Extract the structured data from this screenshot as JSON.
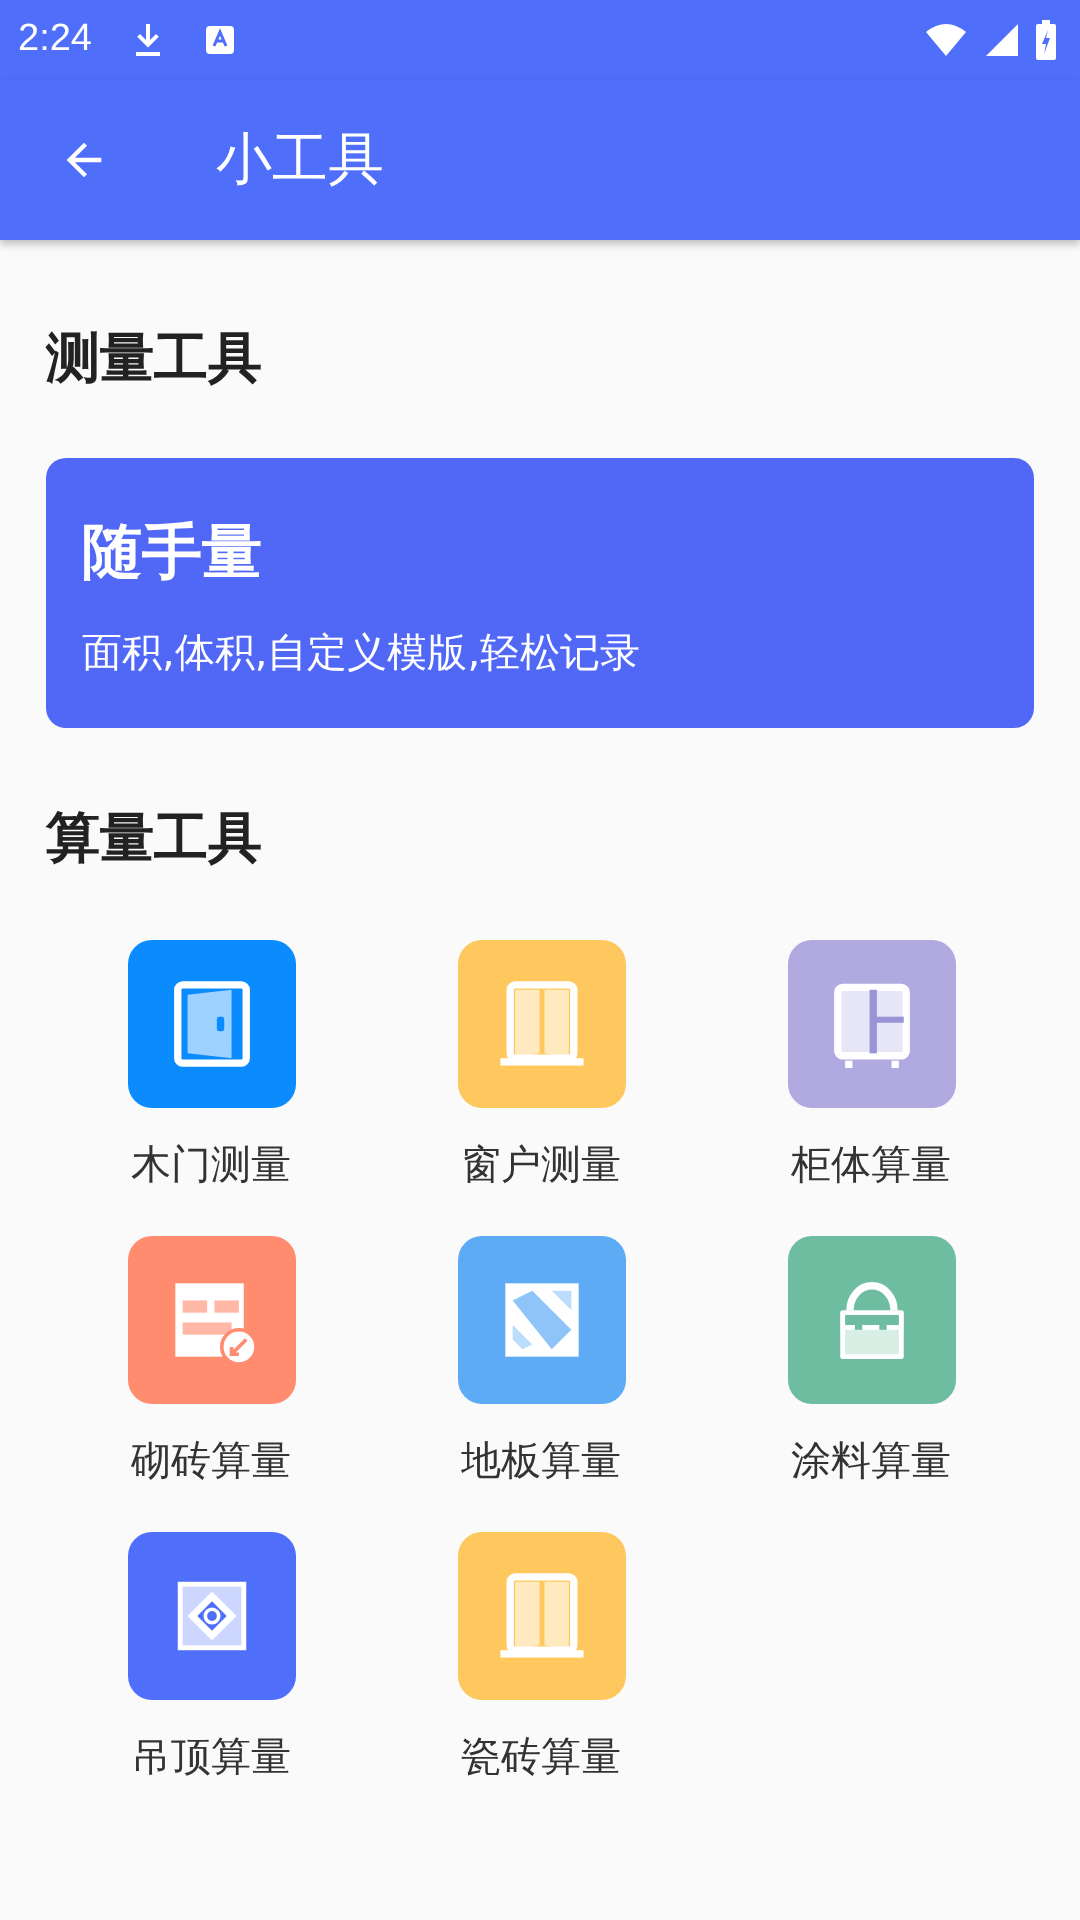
{
  "status_bar": {
    "time": "2:24"
  },
  "app_bar": {
    "title": "小工具"
  },
  "sections": [
    {
      "title": "测量工具",
      "card": {
        "title": "随手量",
        "subtitle": "面积,体积,自定义模版,轻松记录"
      }
    },
    {
      "title": "算量工具",
      "tools": [
        {
          "label": "木门测量",
          "kind": "door",
          "color": "#0a8cff"
        },
        {
          "label": "窗户测量",
          "kind": "wardrobe",
          "color": "#ffc85f"
        },
        {
          "label": "柜体算量",
          "kind": "cabinet",
          "color": "#b0aae0"
        },
        {
          "label": "砌砖算量",
          "kind": "brick",
          "color": "#ff8c6e"
        },
        {
          "label": "地板算量",
          "kind": "floor",
          "color": "#5eabf5"
        },
        {
          "label": "涂料算量",
          "kind": "paint",
          "color": "#6fbda0"
        },
        {
          "label": "吊顶算量",
          "kind": "ceiling",
          "color": "#4f6ffb"
        },
        {
          "label": "瓷砖算量",
          "kind": "wardrobe",
          "color": "#ffc85f"
        }
      ]
    }
  ]
}
